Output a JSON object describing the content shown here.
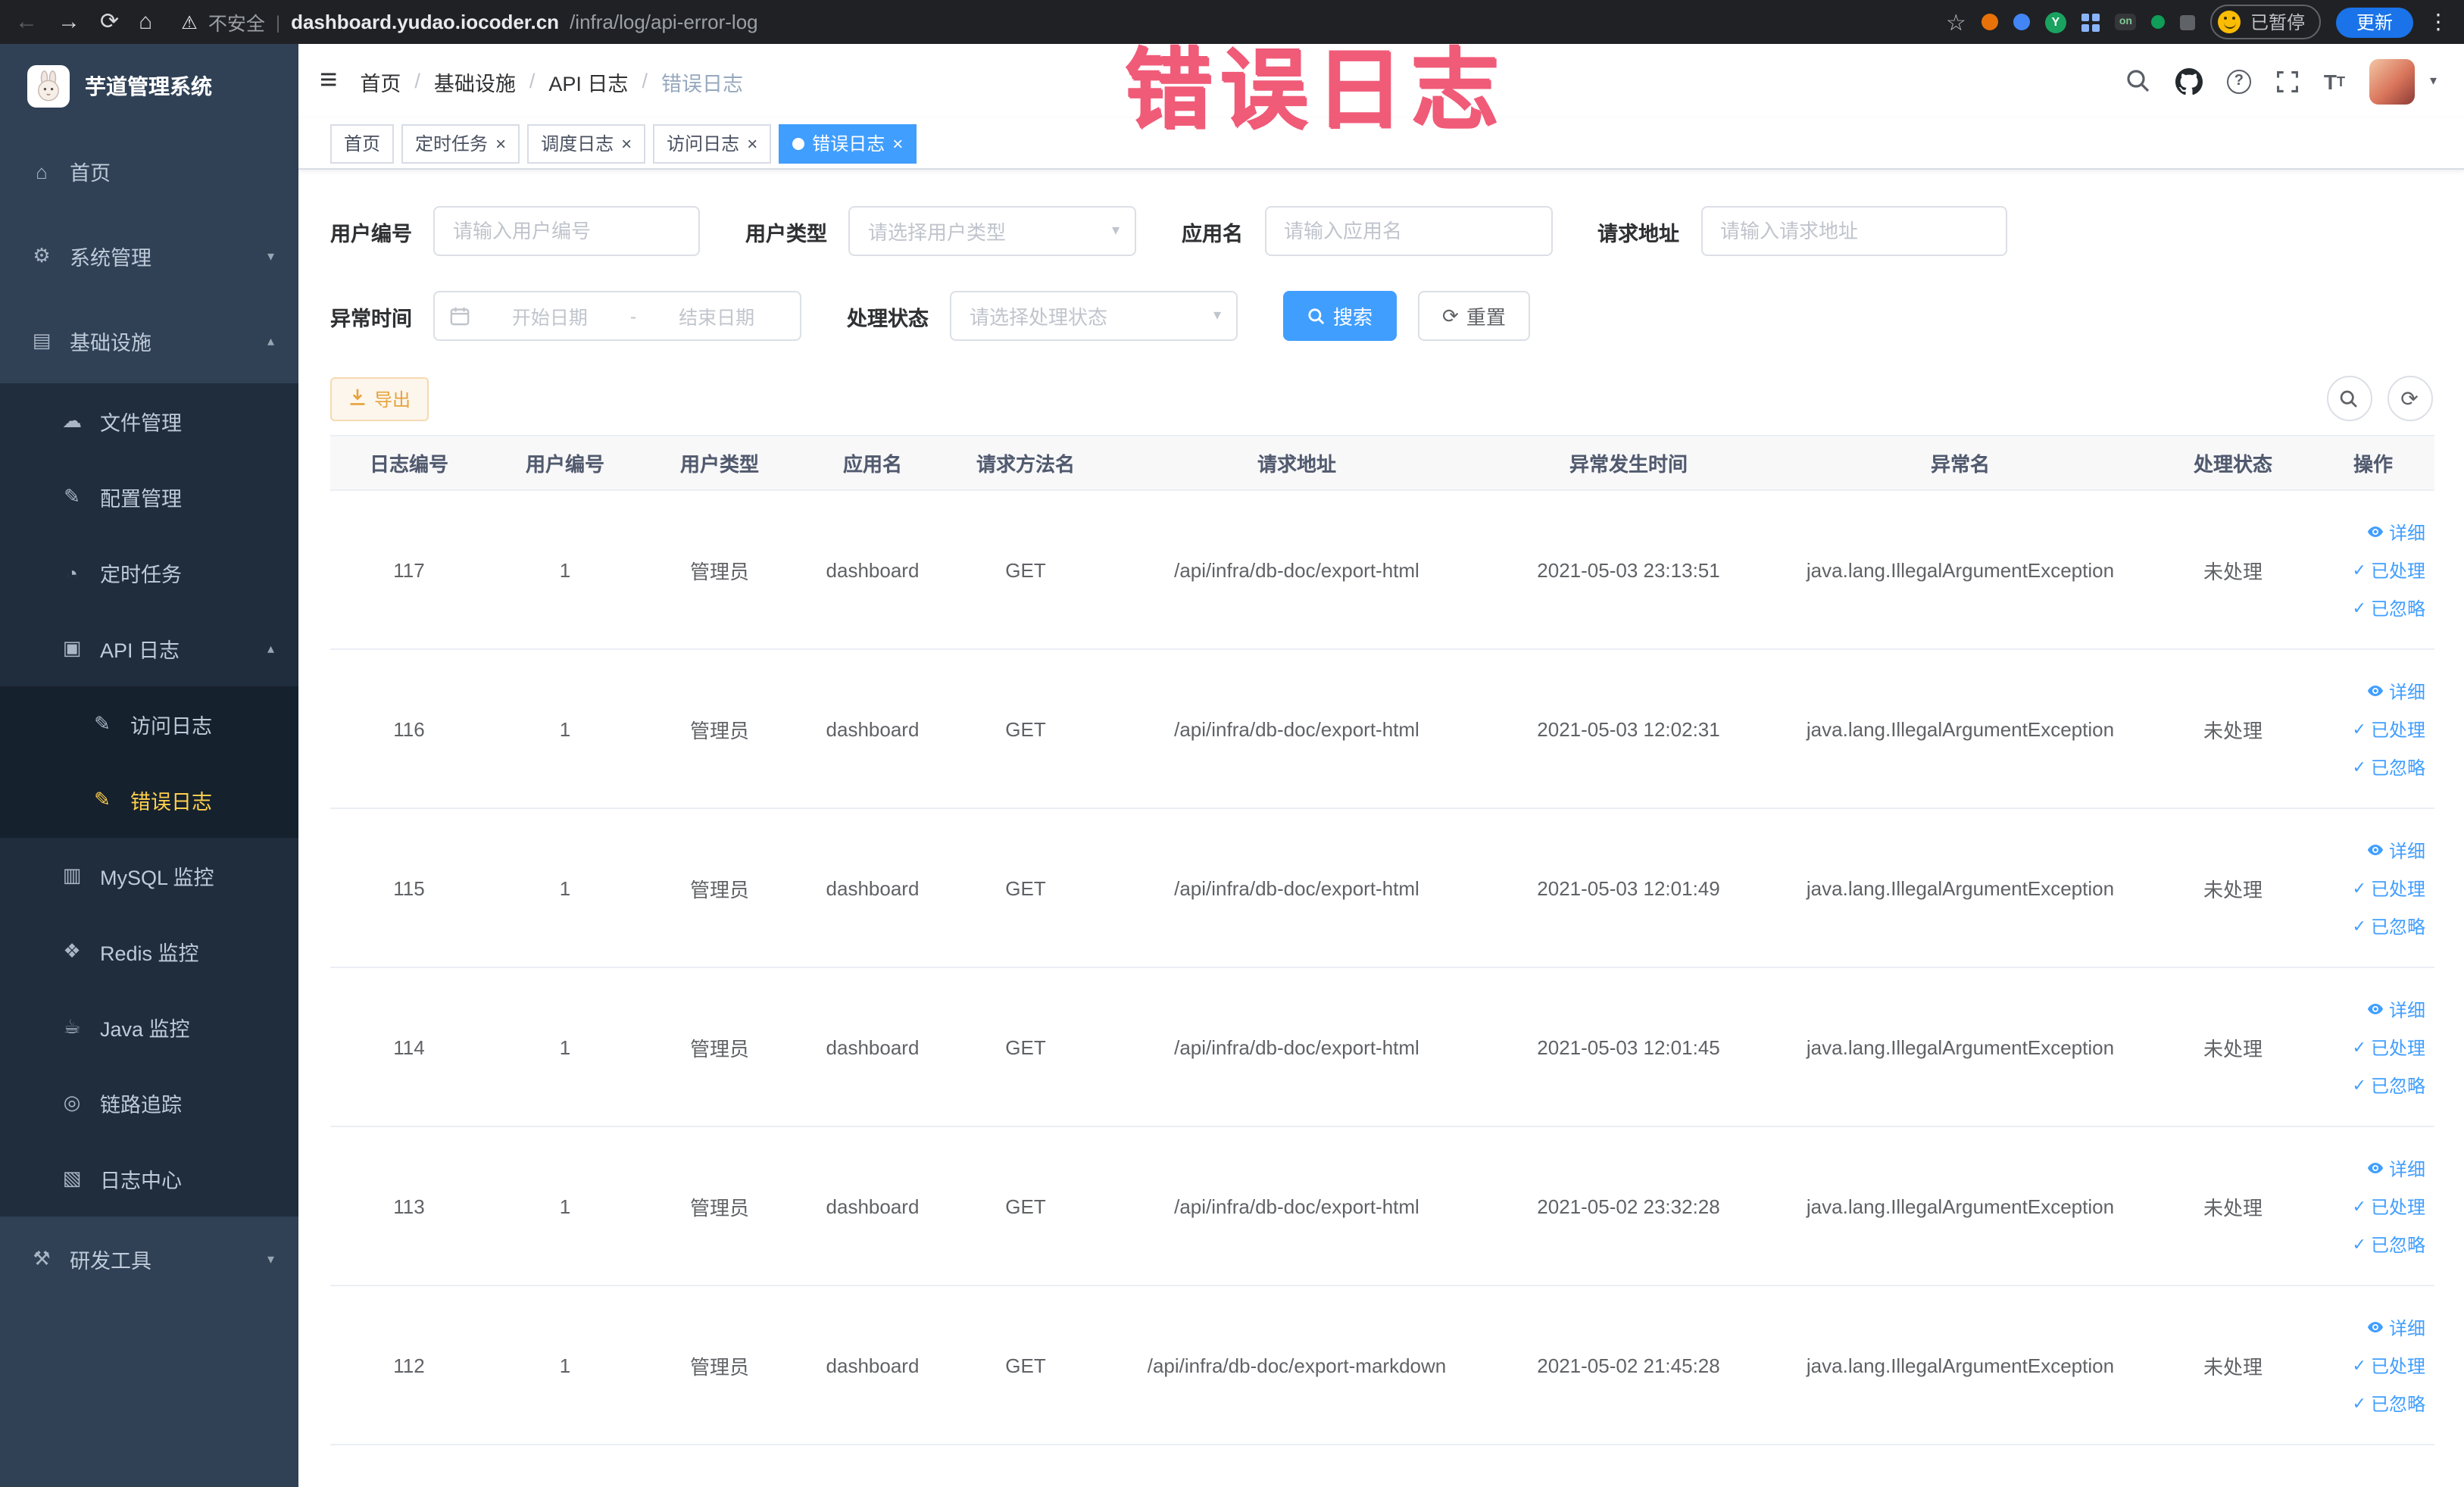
{
  "browser": {
    "security_text": "不安全",
    "url_domain": "dashboard.yudao.iocoder.cn",
    "url_path": "/infra/log/api-error-log",
    "extension_letter": "Y",
    "extension_on_badge": "on",
    "paused_label": "已暂停",
    "update_label": "更新"
  },
  "watermark": "错误日志",
  "icons": {
    "back": "←",
    "forward": "→",
    "reload": "⟳",
    "home_nav": "⌂",
    "warning": "⚠",
    "star": "☆",
    "more": "⋮",
    "hamburger": "≡",
    "home": "⌂",
    "gear": "⚙",
    "infra": "▤",
    "file": "☁",
    "config": "✎",
    "job": "◔",
    "api_log": "▣",
    "access_log": "✎",
    "error_log": "✎",
    "mysql": "▥",
    "redis": "❖",
    "java": "☕",
    "trace": "◎",
    "log_center": "▧",
    "devtools": "⚒",
    "chevron_down": "▾",
    "chevron_up": "▴",
    "caret_down": "▾",
    "close": "×",
    "check": "✓",
    "refresh": "⟳"
  },
  "sidebar": {
    "logo_title": "芋道管理系统",
    "items": [
      {
        "label": "首页"
      },
      {
        "label": "系统管理"
      },
      {
        "label": "基础设施",
        "children": [
          {
            "label": "文件管理"
          },
          {
            "label": "配置管理"
          },
          {
            "label": "定时任务"
          },
          {
            "label": "API 日志",
            "children": [
              {
                "label": "访问日志"
              },
              {
                "label": "错误日志",
                "active": true
              }
            ]
          },
          {
            "label": "MySQL 监控"
          },
          {
            "label": "Redis 监控"
          },
          {
            "label": "Java 监控"
          },
          {
            "label": "链路追踪"
          },
          {
            "label": "日志中心"
          }
        ]
      },
      {
        "label": "研发工具"
      }
    ]
  },
  "header": {
    "breadcrumb": [
      "首页",
      "基础设施",
      "API 日志",
      "错误日志"
    ],
    "breadcrumb_separator": "/"
  },
  "tabs": [
    {
      "label": "首页"
    },
    {
      "label": "定时任务"
    },
    {
      "label": "调度日志"
    },
    {
      "label": "访问日志"
    },
    {
      "label": "错误日志",
      "active": true
    }
  ],
  "filters": {
    "user_id": {
      "label": "用户编号",
      "placeholder": "请输入用户编号"
    },
    "user_type": {
      "label": "用户类型",
      "placeholder": "请选择用户类型"
    },
    "app_name": {
      "label": "应用名",
      "placeholder": "请输入应用名"
    },
    "request_url": {
      "label": "请求地址",
      "placeholder": "请输入请求地址"
    },
    "exception_time": {
      "label": "异常时间",
      "start_placeholder": "开始日期",
      "separator": "-",
      "end_placeholder": "结束日期"
    },
    "process_status": {
      "label": "处理状态",
      "placeholder": "请选择处理状态"
    },
    "search_label": "搜索",
    "reset_label": "重置"
  },
  "toolbar": {
    "export_label": "导出"
  },
  "table": {
    "columns": [
      "日志编号",
      "用户编号",
      "用户类型",
      "应用名",
      "请求方法名",
      "请求地址",
      "异常发生时间",
      "异常名",
      "处理状态",
      "操作"
    ],
    "actions": [
      "详细",
      "已处理",
      "已忽略"
    ],
    "rows": [
      {
        "log_id": "117",
        "user_id": "1",
        "user_type": "管理员",
        "app_name": "dashboard",
        "method": "GET",
        "url": "/api/infra/db-doc/export-html",
        "time": "2021-05-03 23:13:51",
        "exception": "java.lang.IllegalArgumentException",
        "status": "未处理"
      },
      {
        "log_id": "116",
        "user_id": "1",
        "user_type": "管理员",
        "app_name": "dashboard",
        "method": "GET",
        "url": "/api/infra/db-doc/export-html",
        "time": "2021-05-03 12:02:31",
        "exception": "java.lang.IllegalArgumentException",
        "status": "未处理"
      },
      {
        "log_id": "115",
        "user_id": "1",
        "user_type": "管理员",
        "app_name": "dashboard",
        "method": "GET",
        "url": "/api/infra/db-doc/export-html",
        "time": "2021-05-03 12:01:49",
        "exception": "java.lang.IllegalArgumentException",
        "status": "未处理"
      },
      {
        "log_id": "114",
        "user_id": "1",
        "user_type": "管理员",
        "app_name": "dashboard",
        "method": "GET",
        "url": "/api/infra/db-doc/export-html",
        "time": "2021-05-03 12:01:45",
        "exception": "java.lang.IllegalArgumentException",
        "status": "未处理"
      },
      {
        "log_id": "113",
        "user_id": "1",
        "user_type": "管理员",
        "app_name": "dashboard",
        "method": "GET",
        "url": "/api/infra/db-doc/export-html",
        "time": "2021-05-02 23:32:28",
        "exception": "java.lang.IllegalArgumentException",
        "status": "未处理"
      },
      {
        "log_id": "112",
        "user_id": "1",
        "user_type": "管理员",
        "app_name": "dashboard",
        "method": "GET",
        "url": "/api/infra/db-doc/export-markdown",
        "time": "2021-05-02 21:45:28",
        "exception": "java.lang.IllegalArgumentException",
        "status": "未处理"
      }
    ]
  },
  "colors": {
    "primary": "#409eff",
    "sidebar_bg": "#304156",
    "submenu_bg": "#1f2d3d",
    "active_menu_text": "#ffd04b",
    "warning": "#e6a23c",
    "watermark": "#ef4f6e"
  }
}
